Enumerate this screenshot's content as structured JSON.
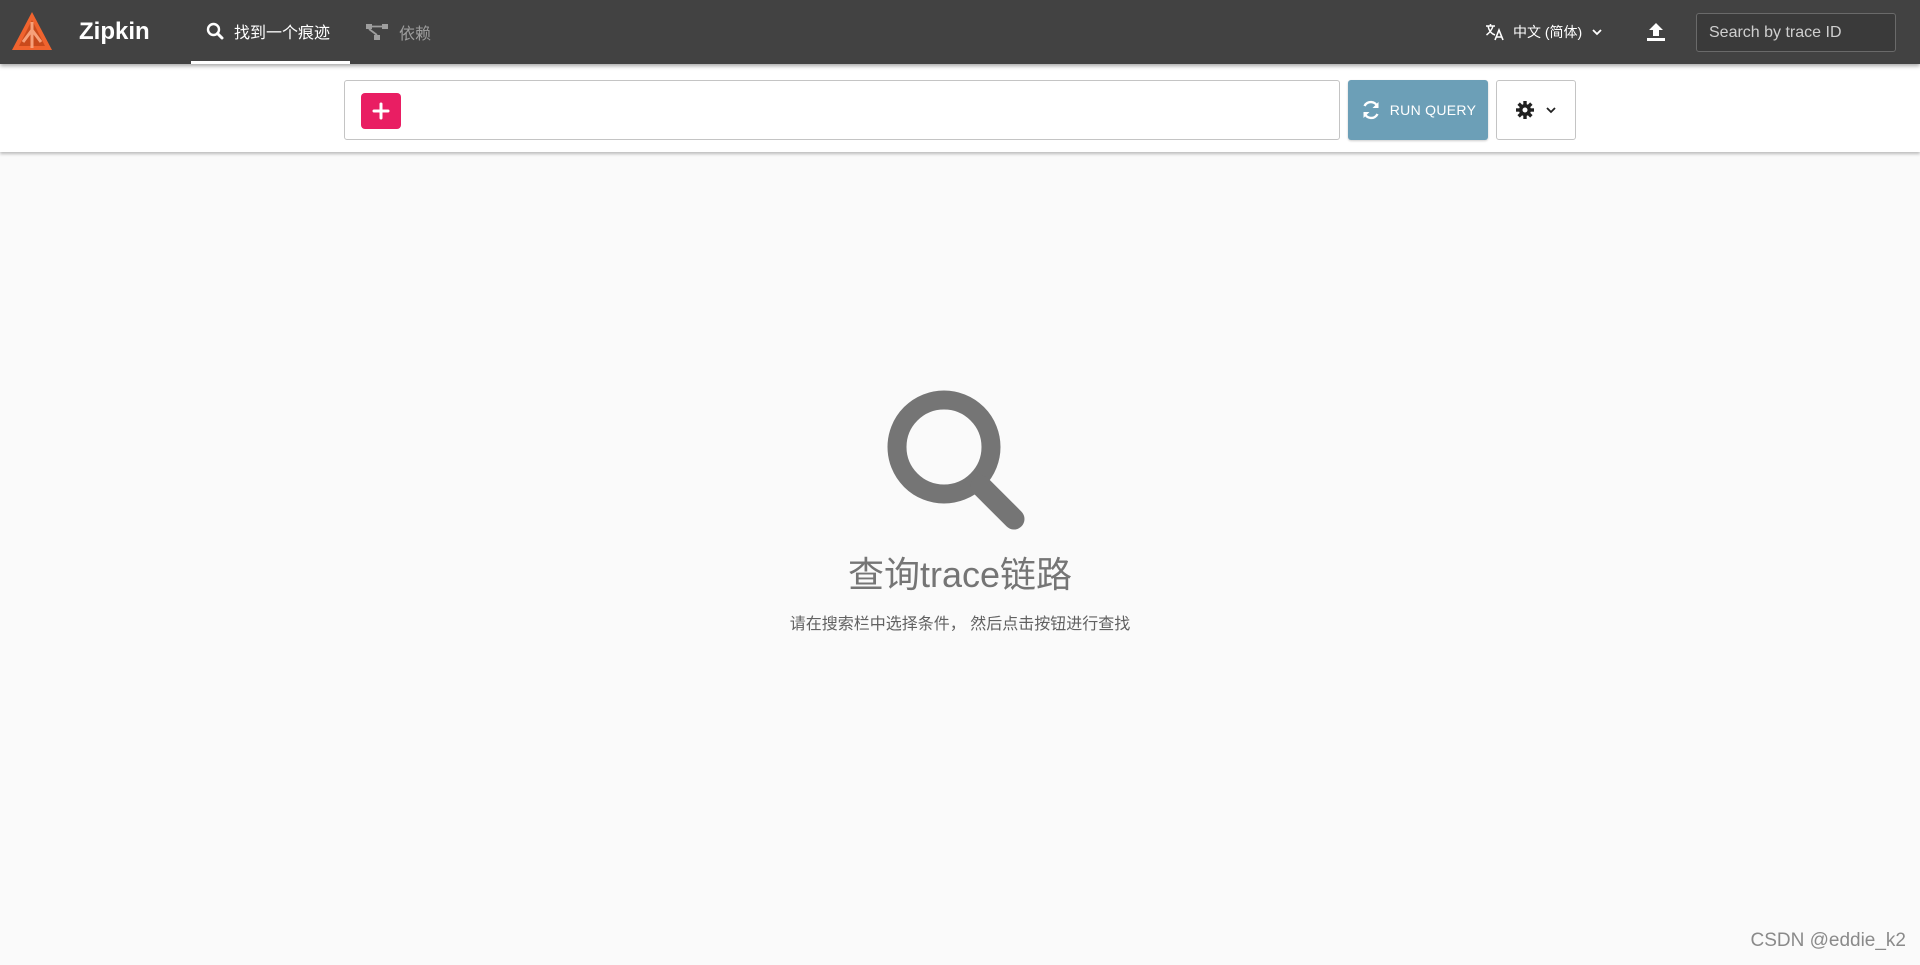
{
  "app": {
    "brand": "Zipkin"
  },
  "nav": {
    "tabs": [
      {
        "label": "找到一个痕迹",
        "icon": "search-icon",
        "active": true
      },
      {
        "label": "依赖",
        "icon": "dependency-graph-icon",
        "active": false
      }
    ]
  },
  "header": {
    "language": {
      "icon": "translate-icon",
      "selected": "中文 (简体)"
    },
    "upload": {
      "icon": "upload-icon"
    },
    "trace_search": {
      "placeholder": "Search by trace ID",
      "value": ""
    }
  },
  "toolbar": {
    "add_icon": "plus-icon",
    "run_query_label": "RUN QUERY",
    "run_query_icon": "refresh-icon",
    "settings_icon": "gear-icon"
  },
  "empty_state": {
    "icon": "magnifier-icon",
    "title": "查询trace链路",
    "subtitle": "请在搜索栏中选择条件， 然后点击按钮进行查找"
  },
  "watermark": "CSDN @eddie_k2",
  "colors": {
    "appbar": "#424242",
    "accent_add": "#e91e63",
    "run_query": "#6c9fb7",
    "logo": "#f0632e"
  }
}
